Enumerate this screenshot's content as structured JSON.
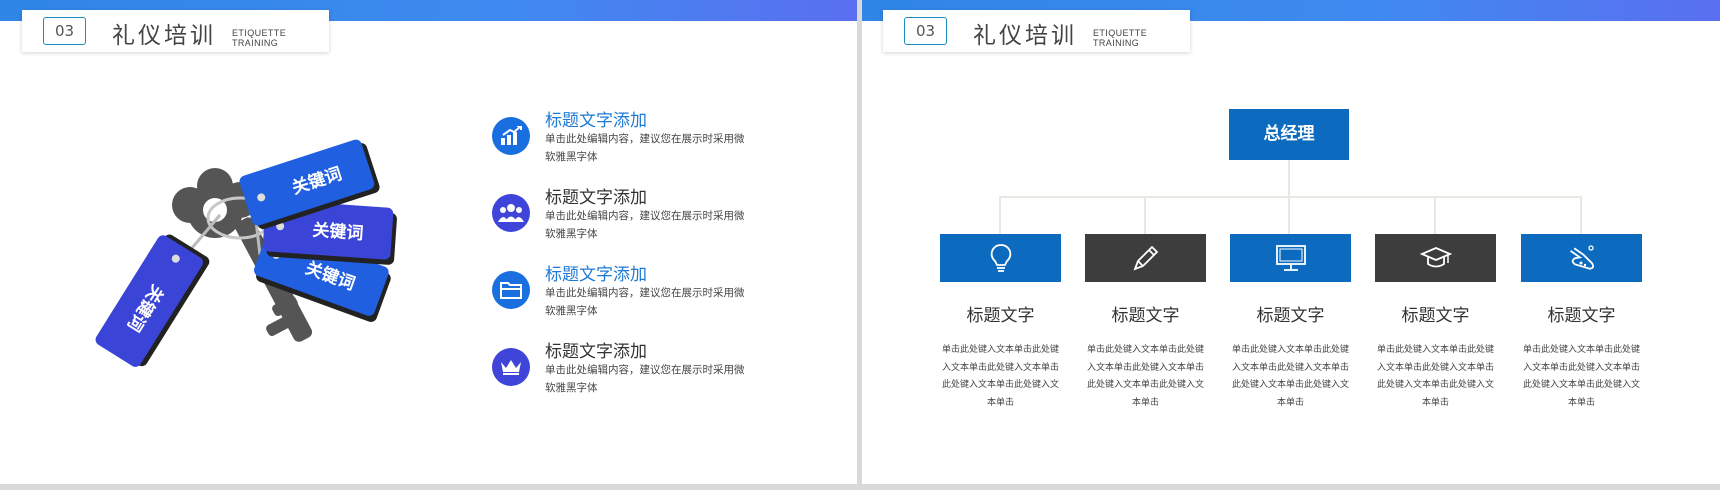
{
  "header": {
    "number": "03",
    "title": "礼仪培训",
    "subtitle": "ETIQUETTE  TRAINING"
  },
  "left_slide": {
    "keyword_tags": [
      "关键词",
      "关键词",
      "关键词",
      "关键词"
    ],
    "items": [
      {
        "title": "标题文字添加",
        "desc": "单击此处编辑内容，建议您在展示时采用微软雅黑字体",
        "icon": "growth-chart-icon",
        "title_color": "#1e7ad6",
        "icon_color": "#1a6fe0"
      },
      {
        "title": "标题文字添加",
        "desc": "单击此处编辑内容，建议您在展示时采用微软雅黑字体",
        "icon": "team-icon",
        "title_color": "#333333",
        "icon_color": "#3e45d8"
      },
      {
        "title": "标题文字添加",
        "desc": "单击此处编辑内容，建议您在展示时采用微软雅黑字体",
        "icon": "folder-icon",
        "title_color": "#1e7ad6",
        "icon_color": "#1a6fe0"
      },
      {
        "title": "标题文字添加",
        "desc": "单击此处编辑内容，建议您在展示时采用微软雅黑字体",
        "icon": "crown-icon",
        "title_color": "#333333",
        "icon_color": "#3e45d8"
      }
    ]
  },
  "right_slide": {
    "top_box": "总经理",
    "units": [
      {
        "title": "标题文字",
        "icon": "lightbulb-icon",
        "color": "#0d6bbf",
        "desc": "单击此处键入文本单击此处键入文本单击此处键入文本单击此处键入文本单击此处键入文本单击"
      },
      {
        "title": "标题文字",
        "icon": "pencil-icon",
        "color": "#3d3d3d",
        "desc": "单击此处键入文本单击此处键入文本单击此处键入文本单击此处键入文本单击此处键入文本单击"
      },
      {
        "title": "标题文字",
        "icon": "monitor-icon",
        "color": "#0d6bbf",
        "desc": "单击此处键入文本单击此处键入文本单击此处键入文本单击此处键入文本单击此处键入文本单击"
      },
      {
        "title": "标题文字",
        "icon": "graduation-cap-icon",
        "color": "#3d3d3d",
        "desc": "单击此处键入文本单击此处键入文本单击此处键入文本单击此处键入文本单击此处键入文本单击"
      },
      {
        "title": "标题文字",
        "icon": "flask-icon",
        "color": "#0d6bbf",
        "desc": "单击此处键入文本单击此处键入文本单击此处键入文本单击此处键入文本单击此处键入文本单击"
      }
    ]
  },
  "colors": {
    "accent_blue": "#0d6bbf",
    "key_gray": "#555555",
    "tag_blue": "#1f5fe0",
    "tag_indigo": "#3a44d6"
  }
}
